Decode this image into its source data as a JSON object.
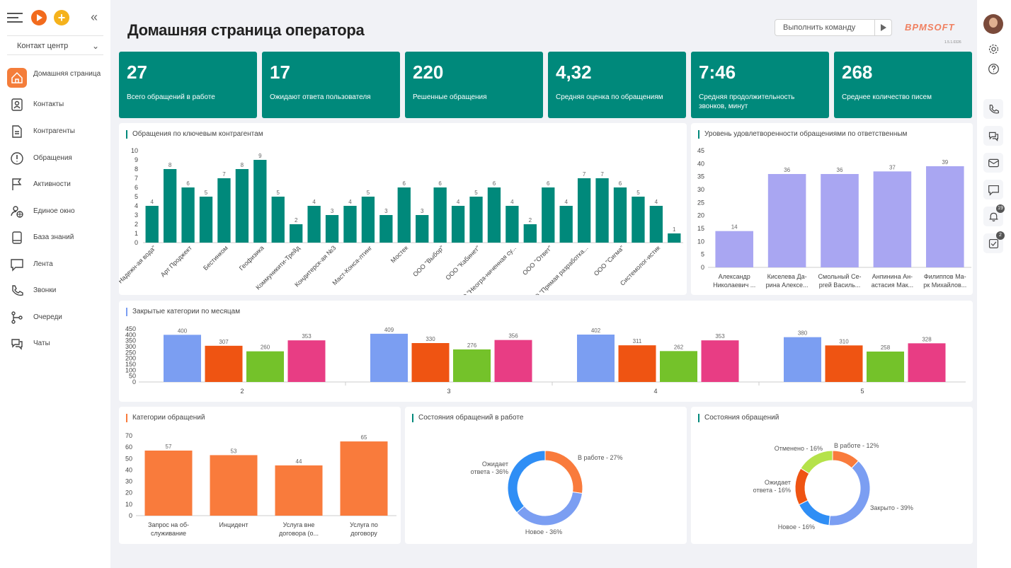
{
  "app": {
    "title": "Домашняя страница оператора",
    "command_placeholder": "Выполнить команду",
    "logo": "BPMSOFT",
    "version": "1.5.1.0326"
  },
  "sidebar": {
    "workspace": "Контакт центр",
    "items": [
      {
        "label": "Домашняя страница",
        "icon": "home-icon",
        "active": true
      },
      {
        "label": "Контакты",
        "icon": "contact-icon"
      },
      {
        "label": "Контрагенты",
        "icon": "document-icon"
      },
      {
        "label": "Обращения",
        "icon": "alert-icon"
      },
      {
        "label": "Активности",
        "icon": "flag-icon"
      },
      {
        "label": "Единое окно",
        "icon": "globe-user-icon"
      },
      {
        "label": "База знаний",
        "icon": "book-icon"
      },
      {
        "label": "Лента",
        "icon": "feed-icon"
      },
      {
        "label": "Звонки",
        "icon": "phone-icon"
      },
      {
        "label": "Очереди",
        "icon": "queue-icon"
      },
      {
        "label": "Чаты",
        "icon": "chat-icon"
      }
    ]
  },
  "kpis": [
    {
      "value": "27",
      "label": "Всего обращений в работе"
    },
    {
      "value": "17",
      "label": "Ожидают ответа пользователя"
    },
    {
      "value": "220",
      "label": "Решенные обращения"
    },
    {
      "value": "4,32",
      "label": "Средняя оценка по обращениям"
    },
    {
      "value": "7:46",
      "label": "Средняя продолжительность звонков, минут"
    },
    {
      "value": "268",
      "label": "Среднее количество писем"
    }
  ],
  "rail": {
    "items": [
      {
        "icon": "settings-icon"
      },
      {
        "icon": "help-icon"
      },
      {
        "icon": "phone-icon"
      },
      {
        "icon": "chat-icon"
      },
      {
        "icon": "mail-icon"
      },
      {
        "icon": "message-icon"
      },
      {
        "icon": "bell-icon",
        "badge": "19"
      },
      {
        "icon": "tasks-icon",
        "badge": "2"
      }
    ]
  },
  "chart_data": [
    {
      "type": "bar",
      "title": "Обращения по ключевым контрагентам",
      "color": "#00897b",
      "ylim": [
        0,
        10
      ],
      "yticks": [
        0,
        1,
        2,
        3,
        4,
        5,
        6,
        7,
        8,
        9,
        10
      ],
      "categories": [
        "АО \"Надежная вода\"",
        "",
        "Арт Проджект",
        "",
        "Бестинком",
        "",
        "Геофизика",
        "",
        "Коммуникати-Трейд",
        "",
        "Кондитерская №3",
        "",
        "Маст-Консалтинг",
        "",
        "Мостек",
        "",
        "ООО \"Выбор\"",
        "",
        "ООО \"Кабинет\"",
        "",
        "ООО \"Неограниченная су...",
        "",
        "ООО \"Ответ\"",
        "",
        "ООО \"Прямая разработка...",
        "",
        "ООО \"Сигма\"",
        "",
        "Системологистик",
        ""
      ],
      "tick_labels": [
        "АО \"Надежн-ая вода\"",
        "Арт Проджект",
        "Бестинком",
        "Геофизика",
        "Коммуникити-Трейд",
        "Кондитерск-ая №3",
        "Маст-Конса-лтинг",
        "Мостек",
        "ООО \"Выбор\"",
        "ООО \"Кабинет\"",
        "ООО \"Неогра-ниченная су...",
        "ООО \"Ответ\"",
        "ООО \"Прямая разработка...",
        "ООО \"Сигма\"",
        "Системолог-истик"
      ],
      "values": [
        4,
        8,
        6,
        5,
        7,
        8,
        9,
        5,
        2,
        4,
        3,
        4,
        5,
        3,
        6,
        3,
        6,
        4,
        5,
        6,
        4,
        2,
        6,
        4,
        7,
        7,
        6,
        5,
        4,
        1
      ]
    },
    {
      "type": "bar",
      "title": "Уровень удовлетворенности обращениями по ответственным",
      "color": "#a9a6f2",
      "ylim": [
        0,
        45
      ],
      "yticks": [
        0,
        5,
        10,
        15,
        20,
        25,
        30,
        35,
        40,
        45
      ],
      "categories": [
        "Александр Николаевич ...",
        "Киселева Дарина Алексе...",
        "Смольный Сергей Василь...",
        "Анпинина Анастасия Мак...",
        "Филиппов Марк Михайлов..."
      ],
      "tick_labels": [
        [
          "Александр",
          "Николаевич ..."
        ],
        [
          "Киселева Да-",
          "рина Алексе..."
        ],
        [
          "Смольный Се-",
          "ргей Василь..."
        ],
        [
          "Анпинина Ан-",
          "астасия Мак..."
        ],
        [
          "Филиппов Ма-",
          "рк Михайлов..."
        ]
      ],
      "values": [
        14,
        36,
        36,
        37,
        39
      ]
    },
    {
      "type": "bar",
      "title": "Закрытые категории по месяцам",
      "ylim": [
        0,
        450
      ],
      "yticks": [
        0,
        50,
        100,
        150,
        200,
        250,
        300,
        350,
        400,
        450
      ],
      "categories": [
        "2",
        "3",
        "4",
        "5"
      ],
      "series": [
        {
          "color": "#7b9ef2",
          "values": [
            400,
            409,
            402,
            380
          ]
        },
        {
          "color": "#ef5412",
          "values": [
            307,
            330,
            311,
            310
          ]
        },
        {
          "color": "#74c22a",
          "values": [
            260,
            276,
            262,
            258
          ]
        },
        {
          "color": "#e83d84",
          "values": [
            353,
            356,
            353,
            328
          ]
        }
      ]
    },
    {
      "type": "bar",
      "title": "Категории обращений",
      "color": "#f97b3c",
      "ylim": [
        0,
        70
      ],
      "yticks": [
        0,
        10,
        20,
        30,
        40,
        50,
        60,
        70
      ],
      "categories": [
        "Запрос на обслуживание",
        "Инцидент",
        "Услуга вне договора (о...",
        "Услуга по договору"
      ],
      "tick_labels": [
        [
          "Запрос на об-",
          "служивание"
        ],
        [
          "Инцидент"
        ],
        [
          "Услуга вне",
          "договора (о..."
        ],
        [
          "Услуга по",
          "договору"
        ]
      ],
      "values": [
        57,
        53,
        44,
        65
      ]
    },
    {
      "type": "pie",
      "title": "Состояния обращений в работе",
      "slices": [
        {
          "label": "В работе - 27%",
          "value": 27,
          "color": "#f97b3c"
        },
        {
          "label": "Новое - 36%",
          "value": 36,
          "color": "#7b9ef2"
        },
        {
          "label": "Ожидает ответа - 36%",
          "value": 36,
          "color": "#2f8ef5"
        }
      ]
    },
    {
      "type": "pie",
      "title": "Состояния обращений",
      "slices": [
        {
          "label": "В работе - 12%",
          "value": 12,
          "color": "#f97b3c"
        },
        {
          "label": "Закрыто - 39%",
          "value": 39,
          "color": "#7b9ef2"
        },
        {
          "label": "Новое - 16%",
          "value": 16,
          "color": "#2f8ef5"
        },
        {
          "label": "Ожидает ответа - 16%",
          "value": 16,
          "color": "#ef5412"
        },
        {
          "label": "Отменено - 16%",
          "value": 16,
          "color": "#b5e24a"
        }
      ]
    }
  ]
}
